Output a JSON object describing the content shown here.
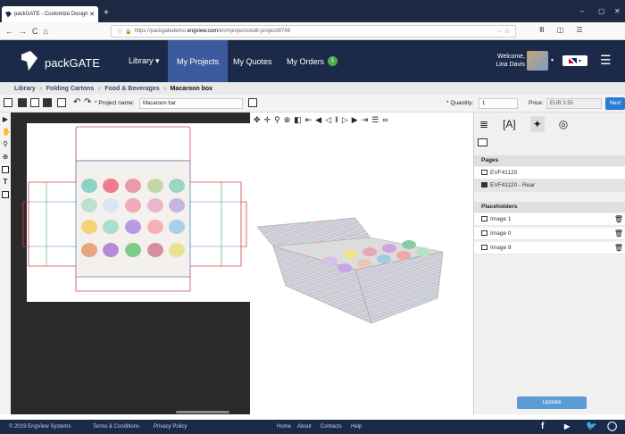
{
  "browser": {
    "tab_title": "packGATE - Customize Design",
    "url_prefix": "https://packgatedemo.",
    "url_host": "engview.com",
    "url_path": "/en/#projects/edit-project/8748",
    "nav_back": "←",
    "nav_forward": "→",
    "nav_reload": "C",
    "nav_home": "⌂",
    "url_actions": "··· ☆",
    "toolbar_icons": "Ⅲ ◫ ☰"
  },
  "header": {
    "brand": "packGATE",
    "menu": [
      {
        "label": "Library ▾"
      },
      {
        "label": "My Projects"
      },
      {
        "label": "My Quotes"
      },
      {
        "label": "My Orders"
      }
    ],
    "orders_badge": "1",
    "welcome": "Welcome,",
    "user_name": "Lina Davis",
    "language": "▾"
  },
  "breadcrumb": [
    "Library",
    "Folding Cartons",
    "Food & Beverages",
    "Macaroon box"
  ],
  "toolbar": {
    "project_name_label": "* Project name:",
    "project_name_value": "Macaroon bar",
    "quantity_label": "* Quantity:",
    "quantity_value": "1",
    "price_label": "Price:",
    "price_value": "EUR 3.50",
    "next_label": "Next"
  },
  "panel": {
    "pages_header": "Pages",
    "pages": [
      "EVF41120",
      "EVF41120 - Rear"
    ],
    "placeholders_header": "Placeholders",
    "placeholders": [
      "Image 1",
      "Image 0",
      "Image 9"
    ],
    "update_label": "Update"
  },
  "footer": {
    "copyright": "© 2019 EngView Systems",
    "terms": "Terms & Conditions",
    "privacy": "Privacy Policy",
    "home": "Home",
    "about": "About",
    "contacts": "Contacts",
    "help": "Help"
  },
  "colors": {
    "header_bg": "#1c2a4a",
    "active_menu": "#3d5a9e",
    "badge": "#4caf50",
    "next_button": "#2a7bd4",
    "dieline": "#d9414b",
    "crease": "#3fa84a"
  }
}
